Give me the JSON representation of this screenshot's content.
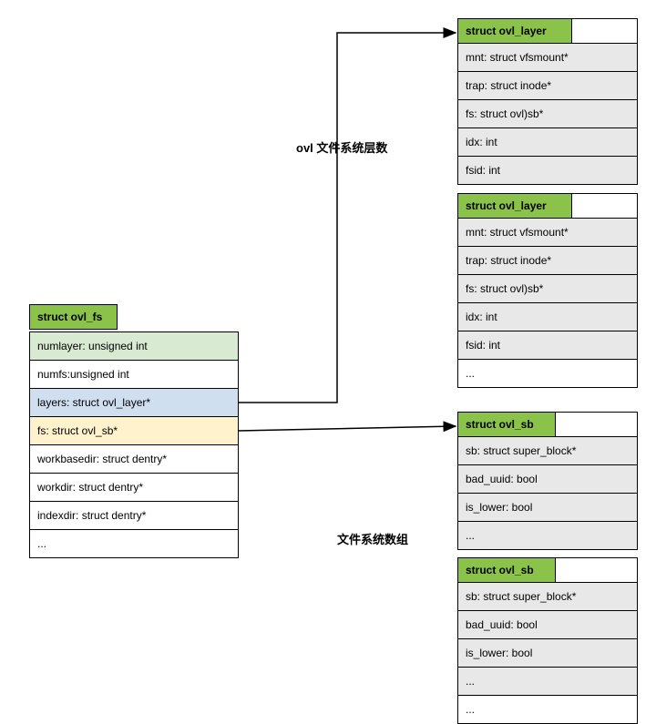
{
  "labels": {
    "layer_count": "ovl 文件系统层数",
    "fs_count": "文件系统数组"
  },
  "ovl_fs": {
    "title": "struct ovl_fs",
    "fields": [
      "numlayer: unsigned int",
      "numfs:unsigned int",
      "layers: struct ovl_layer*",
      "fs: struct ovl_sb*",
      "workbasedir: struct dentry*",
      "workdir: struct dentry*",
      "indexdir: struct dentry*",
      "..."
    ]
  },
  "ovl_layer_1": {
    "title": "struct ovl_layer",
    "fields": [
      "mnt: struct vfsmount*",
      "trap: struct inode*",
      "fs: struct ovl)sb*",
      "idx: int",
      "fsid: int"
    ]
  },
  "ovl_layer_2": {
    "title": "struct ovl_layer",
    "fields": [
      "mnt: struct vfsmount*",
      "trap: struct inode*",
      "fs: struct ovl)sb*",
      "idx: int",
      "fsid: int",
      "..."
    ]
  },
  "ovl_sb_1": {
    "title": "struct ovl_sb",
    "fields": [
      "sb: struct super_block*",
      "bad_uuid: bool",
      "is_lower: bool",
      "..."
    ]
  },
  "ovl_sb_2": {
    "title": "struct ovl_sb",
    "fields": [
      "sb: struct super_block*",
      "bad_uuid: bool",
      "is_lower: bool",
      "...",
      "..."
    ]
  },
  "chart_data": {
    "type": "diagram",
    "description": "C struct relationship diagram for overlay filesystem (ovl)",
    "nodes": [
      {
        "id": "ovl_fs",
        "type": "struct",
        "name": "struct ovl_fs",
        "fields": [
          "numlayer: unsigned int",
          "numfs:unsigned int",
          "layers: struct ovl_layer*",
          "fs: struct ovl_sb*",
          "workbasedir: struct dentry*",
          "workdir: struct dentry*",
          "indexdir: struct dentry*",
          "..."
        ]
      },
      {
        "id": "ovl_layer_1",
        "type": "struct",
        "name": "struct ovl_layer",
        "fields": [
          "mnt: struct vfsmount*",
          "trap: struct inode*",
          "fs: struct ovl)sb*",
          "idx: int",
          "fsid: int"
        ]
      },
      {
        "id": "ovl_layer_2",
        "type": "struct",
        "name": "struct ovl_layer",
        "fields": [
          "mnt: struct vfsmount*",
          "trap: struct inode*",
          "fs: struct ovl)sb*",
          "idx: int",
          "fsid: int",
          "..."
        ]
      },
      {
        "id": "ovl_sb_1",
        "type": "struct",
        "name": "struct ovl_sb",
        "fields": [
          "sb: struct super_block*",
          "bad_uuid: bool",
          "is_lower: bool",
          "..."
        ]
      },
      {
        "id": "ovl_sb_2",
        "type": "struct",
        "name": "struct ovl_sb",
        "fields": [
          "sb: struct super_block*",
          "bad_uuid: bool",
          "is_lower: bool",
          "...",
          "..."
        ]
      }
    ],
    "edges": [
      {
        "from": "ovl_fs",
        "from_field": "layers",
        "to": "ovl_layer_1",
        "label": "ovl 文件系统层数"
      },
      {
        "from": "ovl_fs",
        "from_field": "fs",
        "to": "ovl_sb_1",
        "label": "文件系统数组"
      }
    ]
  }
}
